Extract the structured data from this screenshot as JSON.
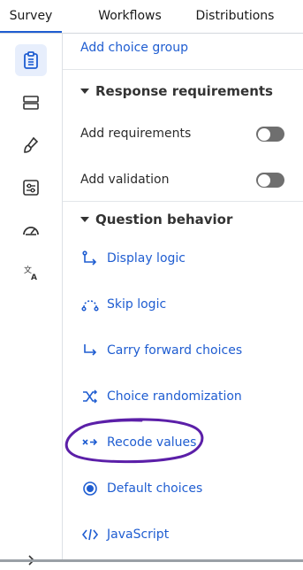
{
  "tabs": [
    "Survey",
    "Workflows",
    "Distributions"
  ],
  "add_choice_group": "Add choice group",
  "response_requirements": {
    "title": "Response requirements",
    "add_requirements": "Add requirements",
    "add_validation": "Add validation"
  },
  "question_behavior": {
    "title": "Question behavior",
    "items": [
      {
        "label": "Display logic",
        "icon": "display-logic-icon"
      },
      {
        "label": "Skip logic",
        "icon": "skip-logic-icon"
      },
      {
        "label": "Carry forward choices",
        "icon": "carry-forward-icon"
      },
      {
        "label": "Choice randomization",
        "icon": "shuffle-icon"
      },
      {
        "label": "Recode values",
        "icon": "recode-icon"
      },
      {
        "label": "Default choices",
        "icon": "radio-icon"
      },
      {
        "label": "JavaScript",
        "icon": "code-icon"
      }
    ]
  },
  "colors": {
    "accent": "#1f5dd1",
    "annotation": "#5b1fa8",
    "toggle_off": "#6f6f6f"
  }
}
